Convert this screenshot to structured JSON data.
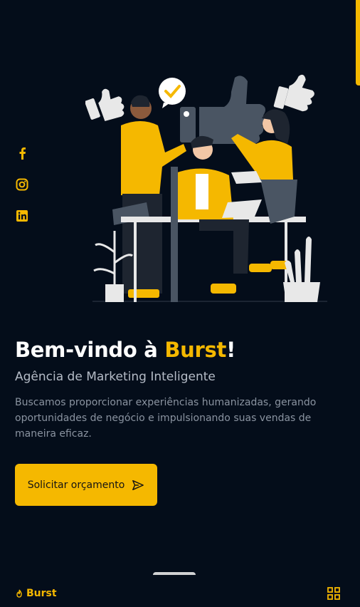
{
  "hero": {
    "title_prefix": "Bem-vindo à ",
    "title_brand": "Burst",
    "title_suffix": "!",
    "subtitle": "Agência de Marketing Inteligente",
    "description": "Buscamos proporcionar experiências humanizadas, gerando oportunidades de negócio e impulsionando suas vendas de maneira eficaz.",
    "cta_label": "Solicitar orçamento"
  },
  "social": {
    "items": [
      {
        "icon": "facebook-icon"
      },
      {
        "icon": "instagram-icon"
      },
      {
        "icon": "linkedin-icon"
      }
    ]
  },
  "bottom_bar": {
    "logo_text": "Burst",
    "menu_icon": "qr-grid-icon"
  },
  "colors": {
    "background": "#040d1a",
    "accent": "#f5b800",
    "text_muted": "#8a93a0",
    "subtitle": "#b5bcc7"
  }
}
